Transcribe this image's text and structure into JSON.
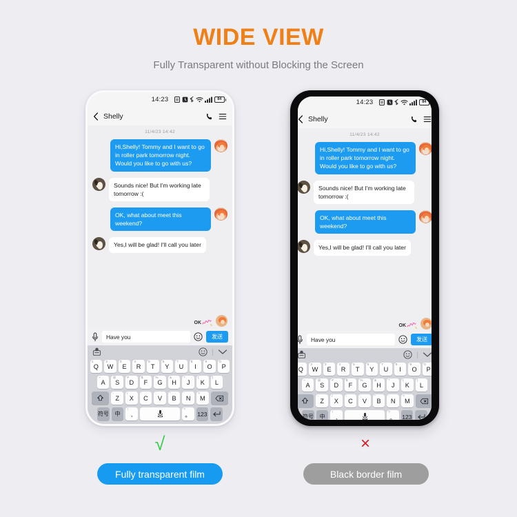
{
  "header": {
    "title": "WIDE VIEW",
    "subtitle": "Fully Transparent without Blocking the Screen"
  },
  "colors": {
    "background": "#eeedf2",
    "title_orange": "#ef8017",
    "bubble_blue": "#1d9bf0",
    "pill_blue": "#169bf0",
    "pill_gray": "#9e9e9e",
    "check_green": "#2ecc40",
    "cross_red": "#cf1b25",
    "black_bezel": "#0b0b0d"
  },
  "phone": {
    "status_bar": {
      "time": "14:23",
      "battery_level": "84",
      "icons": [
        "app-icon",
        "alarm-icon",
        "bluetooth-icon",
        "wifi-icon",
        "signal-icon",
        "battery-icon"
      ]
    },
    "chat_header": {
      "back_icon": "chevron-left-icon",
      "contact_name": "Shelly",
      "call_icon": "phone-icon",
      "menu_icon": "hamburger-menu-icon"
    },
    "conversation": {
      "date_divider": "11/4/23 14:42",
      "messages": [
        {
          "side": "out",
          "avatar": "girl-avatar",
          "text": "Hi,Shelly!\nTommy and I want to go in roller park tomorrow night. Would you like to go with us?"
        },
        {
          "side": "in",
          "avatar": "dog-avatar",
          "text": "Sounds nice!\nBut I'm working late tomorrow :("
        },
        {
          "side": "out",
          "avatar": "girl-avatar",
          "text": "OK, what about meet this weekend?"
        },
        {
          "side": "in",
          "avatar": "dog-avatar",
          "text": "Yes,I will be glad!\nI'll call you later"
        }
      ],
      "sticker": {
        "label": "OK",
        "avatar": "girl-avatar"
      }
    },
    "composer": {
      "mic_icon": "microphone-icon",
      "input_value": "Have you",
      "input_placeholder": "Have you",
      "emoji_icon": "smiley-icon",
      "send_label": "发送"
    },
    "keyboard": {
      "toolbar": {
        "sticker_icon": "sticker-face-icon",
        "emoji_icon": "smiley-icon",
        "collapse_icon": "chevron-down-icon"
      },
      "row1": [
        {
          "key": "Q",
          "sup": "1"
        },
        {
          "key": "W",
          "sup": "2"
        },
        {
          "key": "E",
          "sup": "3"
        },
        {
          "key": "R",
          "sup": "4"
        },
        {
          "key": "T",
          "sup": "5"
        },
        {
          "key": "Y",
          "sup": "6"
        },
        {
          "key": "U",
          "sup": "7"
        },
        {
          "key": "I",
          "sup": "8"
        },
        {
          "key": "O",
          "sup": "9"
        },
        {
          "key": "P",
          "sup": "0"
        }
      ],
      "row2": [
        {
          "key": "A",
          "sup": "~"
        },
        {
          "key": "S",
          "sup": "@"
        },
        {
          "key": "D",
          "sup": "#"
        },
        {
          "key": "F",
          "sup": "$"
        },
        {
          "key": "G",
          "sup": "%"
        },
        {
          "key": "H",
          "sup": "&"
        },
        {
          "key": "J",
          "sup": "*"
        },
        {
          "key": "K",
          "sup": "("
        },
        {
          "key": "L",
          "sup": ")"
        }
      ],
      "row3": [
        {
          "key": "Z",
          "sup": "-"
        },
        {
          "key": "X",
          "sup": "/"
        },
        {
          "key": "C",
          "sup": ":"
        },
        {
          "key": "V",
          "sup": ";"
        },
        {
          "key": "B",
          "sup": "\""
        },
        {
          "key": "N",
          "sup": "'"
        },
        {
          "key": "M",
          "sup": "?"
        }
      ],
      "shift_icon": "shift-arrow-icon",
      "backspace_icon": "backspace-icon",
      "row4": {
        "symbols_label": "符号",
        "lang_label": "中",
        "comma_key": ",",
        "comma_sup": "!",
        "space_icon": "microphone-icon",
        "period_key": "。",
        "period_sup": "?",
        "num_label": "123",
        "enter_icon": "enter-arrow-icon"
      }
    }
  },
  "comparison": {
    "left": {
      "mark": "√",
      "mark_name": "check-mark",
      "pill_label": "Fully transparent film"
    },
    "right": {
      "mark": "×",
      "mark_name": "cross-mark",
      "pill_label": "Black border film"
    }
  }
}
